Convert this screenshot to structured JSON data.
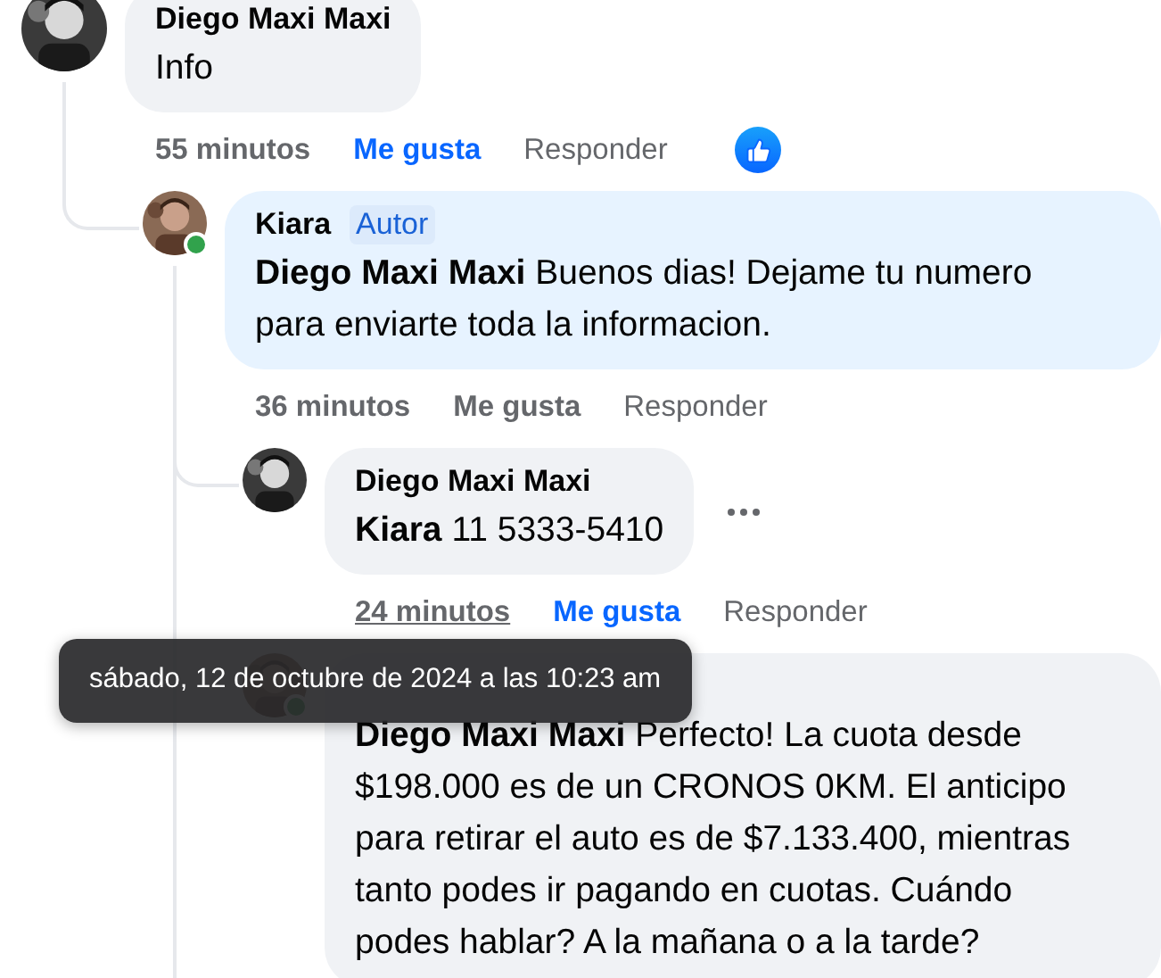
{
  "comments": [
    {
      "author": "Diego Maxi Maxi",
      "text": "Info",
      "time": "55 minutos",
      "time_hovered": false,
      "like_label": "Me gusta",
      "liked": true,
      "reply_label": "Responder",
      "has_reaction": true,
      "children": [
        {
          "author": "Kiara",
          "badge": "Autor",
          "own": true,
          "mention": "Diego Maxi Maxi",
          "text": "Buenos dias! Dejame tu numero para enviarte toda la informacion.",
          "time": "36 minutos",
          "time_hovered": false,
          "like_label": "Me gusta",
          "liked": false,
          "reply_label": "Responder",
          "online": true,
          "thread_continues": true,
          "children": [
            {
              "author": "Diego Maxi Maxi",
              "mention": "Kiara",
              "text": "11 5333-5410",
              "time": "24 minutos",
              "time_hovered": true,
              "like_label": "Me gusta",
              "liked": true,
              "reply_label": "Responder",
              "menu_visible": true
            },
            {
              "mention": "Diego Maxi Maxi",
              "text": "Perfecto! La cuota desde $198.000 es de un CRONOS 0KM. El anticipo para retirar el auto es de $7.133.400, mientras tanto podes ir pagando en cuotas. Cuándo podes hablar? A la mañana o a la tarde?",
              "online": true
            }
          ]
        }
      ]
    }
  ],
  "tooltip": {
    "text": "sábado, 12 de octubre de 2024 a las 10:23 am"
  }
}
